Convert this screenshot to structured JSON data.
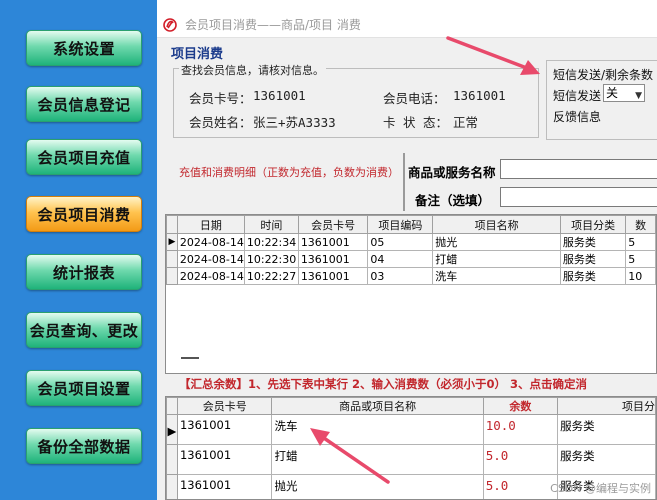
{
  "sidebar": {
    "items": [
      {
        "label": "系统设置"
      },
      {
        "label": "会员信息登记"
      },
      {
        "label": "会员项目充值"
      },
      {
        "label": "会员项目消费"
      },
      {
        "label": "统计报表"
      },
      {
        "label": "会员查询、更改"
      },
      {
        "label": "会员项目设置"
      },
      {
        "label": "备份全部数据"
      }
    ],
    "active_index": 3
  },
  "window": {
    "title": "会员项目消费——商品/项目 消费",
    "section_title": "项目消费"
  },
  "member_info": {
    "legend": "查找会员信息，请核对信息。",
    "card_label": "会员卡号：",
    "card_value": "1361001",
    "phone_label": "会员电话：",
    "phone_value": "1361001",
    "name_label": "会员姓名：",
    "name_value": "张三+苏A3333",
    "status_label": "卡 状 态：",
    "status_value": "正常"
  },
  "sms": {
    "header": "短信发送/剩余条数",
    "send_label": "短信发送",
    "send_value": "关",
    "feedback_label": "反馈信息"
  },
  "detail": {
    "label": "充值和消费明细（正数为充值，负数为消费）",
    "product_label": "商品或服务名称",
    "remark_label": "备注（选填）"
  },
  "history_table": {
    "columns": [
      "日期",
      "时间",
      "会员卡号",
      "项目编码",
      "项目名称",
      "项目分类",
      "数"
    ],
    "rows": [
      [
        "2024-08-14",
        "10:22:34",
        "1361001",
        "05",
        "抛光",
        "服务类",
        "5"
      ],
      [
        "2024-08-14",
        "10:22:30",
        "1361001",
        "04",
        "打蜡",
        "服务类",
        "5"
      ],
      [
        "2024-08-14",
        "10:22:27",
        "1361001",
        "03",
        "洗车",
        "服务类",
        "10"
      ]
    ]
  },
  "summary_bar": "【汇总余数】1、先选下表中某行  2、输入消费数（必须小于0）  3、点击确定消",
  "balance_table": {
    "columns": [
      "会员卡号",
      "商品或项目名称",
      "余数",
      "项目分"
    ],
    "rows": [
      [
        "1361001",
        "洗车",
        "10.0",
        "服务类"
      ],
      [
        "1361001",
        "打蜡",
        "5.0",
        "服务类"
      ],
      [
        "1361001",
        "抛光",
        "5.0",
        "服务类"
      ]
    ]
  },
  "watermark": "CSDN @编程与实例",
  "colors": {
    "sidebar_bg": "#2d86d8",
    "button_green": "#1fb37a",
    "button_active_orange": "#f39a16",
    "title_blue": "#1c3c8c",
    "accent_red": "#c2272d",
    "arrow_pink": "#e84a6b"
  }
}
